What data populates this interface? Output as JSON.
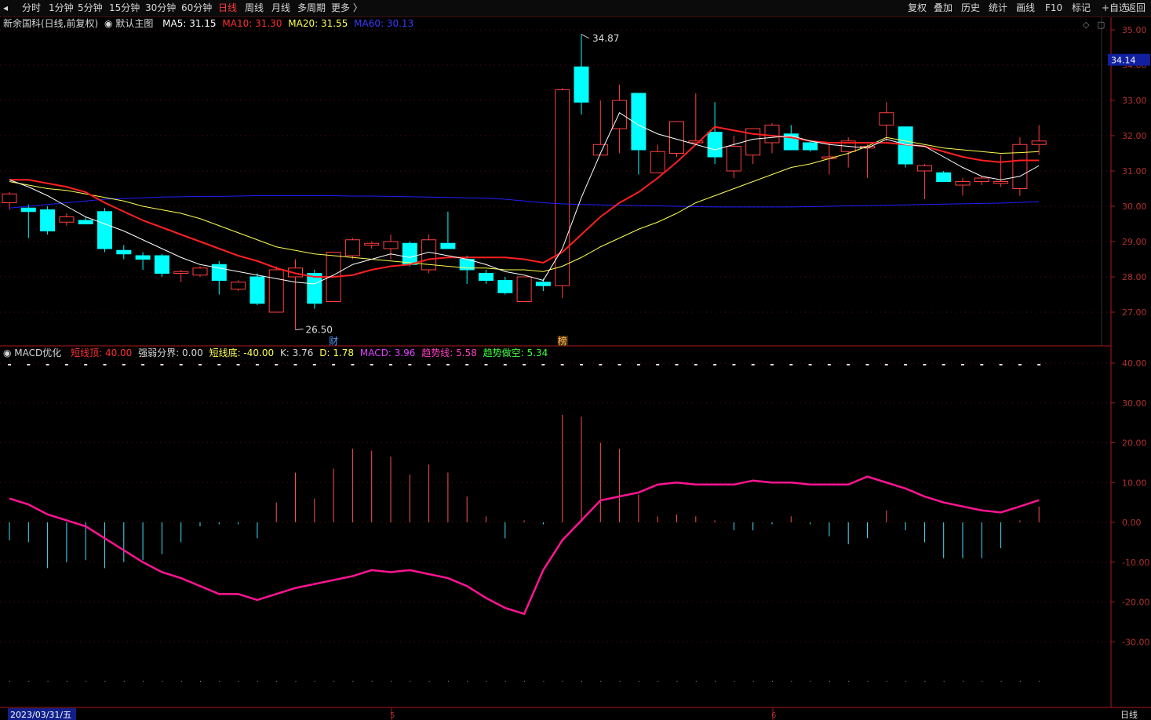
{
  "toolbar": {
    "periods": [
      "分时",
      "1分钟",
      "5分钟",
      "15分钟",
      "30分钟",
      "60分钟",
      "日线",
      "周线",
      "月线",
      "多周期",
      "更多 〉"
    ],
    "active_period": "日线",
    "right_buttons": [
      "复权",
      "叠加",
      "历史",
      "统计",
      "画线",
      "F10",
      "标记",
      "+自选",
      "返回"
    ]
  },
  "info": {
    "stock": "新余国科(日线,前复权)",
    "template": "默认主图",
    "ma5": "MA5: 31.15",
    "ma10": "MA10: 31.30",
    "ma20": "MA20: 31.55",
    "ma60": "MA60: 30.13"
  },
  "macd_info": {
    "name": "MACD优化",
    "short_top": "短线顶: 40.00",
    "strong_weak": "强弱分界: 0.00",
    "short_bottom": "短线底: -40.00",
    "k": "K: 3.76",
    "d": "D: 1.78",
    "macd": "MACD: 3.96",
    "trend": "趋势线: 5.58",
    "trend_short": "趋势做空: 5.34"
  },
  "colors": {
    "up": "#ff4040",
    "down": "#00ffff",
    "ma5": "#ffffff",
    "ma10": "#ff2020",
    "ma20": "#ffff50",
    "ma60": "#2020ff",
    "trend": "#ff1493",
    "grid": "#5a1010",
    "axis": "#b01818"
  },
  "annotations": {
    "high": "34.87",
    "low": "26.50",
    "marker_cai": "财",
    "marker_bang": "榜",
    "current_price": "34.14",
    "date": "2023/03/31/五",
    "month5": "5",
    "month6": "6",
    "period_label": "日线"
  },
  "chart_data": [
    {
      "type": "candlestick",
      "series": [
        {
          "name": "新余国科"
        }
      ],
      "ylim": [
        26.3,
        35.2
      ],
      "y_ticks": [
        "27.00",
        "28.00",
        "29.00",
        "30.00",
        "31.00",
        "32.00",
        "33.00",
        "34.00",
        "35.00"
      ],
      "candles": [
        {
          "o": 30.1,
          "h": 30.4,
          "l": 29.9,
          "c": 30.35
        },
        {
          "o": 29.95,
          "h": 30.05,
          "l": 29.1,
          "c": 29.85
        },
        {
          "o": 29.9,
          "h": 30.0,
          "l": 29.2,
          "c": 29.3
        },
        {
          "o": 29.55,
          "h": 29.8,
          "l": 29.45,
          "c": 29.7
        },
        {
          "o": 29.6,
          "h": 29.7,
          "l": 29.5,
          "c": 29.5
        },
        {
          "o": 29.85,
          "h": 29.95,
          "l": 28.7,
          "c": 28.8
        },
        {
          "o": 28.75,
          "h": 28.9,
          "l": 28.5,
          "c": 28.65
        },
        {
          "o": 28.6,
          "h": 28.7,
          "l": 28.2,
          "c": 28.5
        },
        {
          "o": 28.6,
          "h": 28.65,
          "l": 28.0,
          "c": 28.1
        },
        {
          "o": 28.1,
          "h": 28.2,
          "l": 27.85,
          "c": 28.15
        },
        {
          "o": 28.05,
          "h": 28.3,
          "l": 28.0,
          "c": 28.25
        },
        {
          "o": 28.35,
          "h": 28.45,
          "l": 27.5,
          "c": 27.9
        },
        {
          "o": 27.65,
          "h": 27.9,
          "l": 27.6,
          "c": 27.85
        },
        {
          "o": 28.0,
          "h": 28.1,
          "l": 27.2,
          "c": 27.25
        },
        {
          "o": 27.0,
          "h": 28.3,
          "l": 27.0,
          "c": 28.2
        },
        {
          "o": 28.0,
          "h": 28.5,
          "l": 26.5,
          "c": 28.25
        },
        {
          "o": 28.1,
          "h": 28.2,
          "l": 27.1,
          "c": 27.25
        },
        {
          "o": 27.3,
          "h": 28.7,
          "l": 27.3,
          "c": 28.7
        },
        {
          "o": 28.6,
          "h": 29.1,
          "l": 28.5,
          "c": 29.05
        },
        {
          "o": 28.9,
          "h": 29.0,
          "l": 28.8,
          "c": 28.95
        },
        {
          "o": 28.8,
          "h": 29.2,
          "l": 28.5,
          "c": 29.0
        },
        {
          "o": 28.95,
          "h": 29.0,
          "l": 28.3,
          "c": 28.35
        },
        {
          "o": 28.2,
          "h": 29.2,
          "l": 28.1,
          "c": 29.05
        },
        {
          "o": 28.95,
          "h": 29.85,
          "l": 28.8,
          "c": 28.8
        },
        {
          "o": 28.5,
          "h": 28.6,
          "l": 27.8,
          "c": 28.2
        },
        {
          "o": 28.1,
          "h": 28.2,
          "l": 27.8,
          "c": 27.9
        },
        {
          "o": 27.9,
          "h": 28.0,
          "l": 27.5,
          "c": 27.55
        },
        {
          "o": 27.3,
          "h": 28.0,
          "l": 27.3,
          "c": 28.0
        },
        {
          "o": 27.85,
          "h": 27.95,
          "l": 27.6,
          "c": 27.75
        },
        {
          "o": 27.75,
          "h": 33.35,
          "l": 27.4,
          "c": 33.3
        },
        {
          "o": 33.95,
          "h": 34.87,
          "l": 32.6,
          "c": 32.95
        },
        {
          "o": 31.45,
          "h": 33.0,
          "l": 31.5,
          "c": 31.75
        },
        {
          "o": 32.2,
          "h": 33.45,
          "l": 31.5,
          "c": 33.0
        },
        {
          "o": 33.2,
          "h": 33.2,
          "l": 30.9,
          "c": 31.6
        },
        {
          "o": 30.95,
          "h": 31.75,
          "l": 30.95,
          "c": 31.55
        },
        {
          "o": 31.5,
          "h": 32.4,
          "l": 31.4,
          "c": 32.4
        },
        {
          "o": 31.8,
          "h": 33.2,
          "l": 31.8,
          "c": 31.85
        },
        {
          "o": 32.1,
          "h": 32.95,
          "l": 31.2,
          "c": 31.4
        },
        {
          "o": 31.0,
          "h": 32.0,
          "l": 30.8,
          "c": 31.7
        },
        {
          "o": 31.45,
          "h": 32.2,
          "l": 31.2,
          "c": 32.2
        },
        {
          "o": 31.8,
          "h": 32.35,
          "l": 31.5,
          "c": 32.3
        },
        {
          "o": 32.05,
          "h": 32.3,
          "l": 31.6,
          "c": 31.6
        },
        {
          "o": 31.8,
          "h": 31.85,
          "l": 31.55,
          "c": 31.6
        },
        {
          "o": 31.35,
          "h": 31.8,
          "l": 30.9,
          "c": 31.4
        },
        {
          "o": 31.55,
          "h": 31.95,
          "l": 31.1,
          "c": 31.85
        },
        {
          "o": 31.65,
          "h": 31.75,
          "l": 30.8,
          "c": 31.7
        },
        {
          "o": 32.3,
          "h": 32.95,
          "l": 31.85,
          "c": 32.65
        },
        {
          "o": 32.25,
          "h": 32.25,
          "l": 31.1,
          "c": 31.2
        },
        {
          "o": 31.0,
          "h": 31.2,
          "l": 30.2,
          "c": 31.15
        },
        {
          "o": 30.95,
          "h": 31.0,
          "l": 30.7,
          "c": 30.7
        },
        {
          "o": 30.6,
          "h": 30.8,
          "l": 30.3,
          "c": 30.7
        },
        {
          "o": 30.7,
          "h": 30.85,
          "l": 30.6,
          "c": 30.8
        },
        {
          "o": 30.65,
          "h": 31.45,
          "l": 30.55,
          "c": 30.7
        },
        {
          "o": 30.5,
          "h": 31.95,
          "l": 30.3,
          "c": 31.75
        },
        {
          "o": 31.75,
          "h": 32.3,
          "l": 31.45,
          "c": 31.85
        }
      ],
      "ma5": [
        30.75,
        30.55,
        30.3,
        30.0,
        29.7,
        29.5,
        29.3,
        29.05,
        28.8,
        28.55,
        28.35,
        28.25,
        28.15,
        28.05,
        27.95,
        27.85,
        27.8,
        28.05,
        28.35,
        28.5,
        28.65,
        28.55,
        28.7,
        28.6,
        28.5,
        28.35,
        28.15,
        28.05,
        27.9,
        28.8,
        30.25,
        31.5,
        32.65,
        32.3,
        32.05,
        31.9,
        31.75,
        31.6,
        31.75,
        31.9,
        31.95,
        32.0,
        31.85,
        31.75,
        31.7,
        31.65,
        31.9,
        31.75,
        31.7,
        31.4,
        31.1,
        30.85,
        30.75,
        30.85,
        31.15
      ],
      "ma10": [
        30.75,
        30.75,
        30.65,
        30.55,
        30.4,
        30.1,
        29.85,
        29.6,
        29.4,
        29.2,
        29.0,
        28.8,
        28.6,
        28.45,
        28.25,
        28.1,
        28.0,
        28.0,
        28.05,
        28.2,
        28.3,
        28.35,
        28.5,
        28.55,
        28.55,
        28.55,
        28.55,
        28.5,
        28.4,
        28.7,
        29.2,
        29.7,
        30.1,
        30.4,
        30.8,
        31.25,
        31.75,
        32.25,
        32.15,
        32.05,
        32.0,
        31.95,
        31.85,
        31.8,
        31.8,
        31.8,
        31.8,
        31.75,
        31.7,
        31.55,
        31.4,
        31.3,
        31.25,
        31.3,
        31.3
      ],
      "ma20": [
        30.7,
        30.6,
        30.5,
        30.45,
        30.35,
        30.25,
        30.15,
        30.0,
        29.9,
        29.8,
        29.65,
        29.45,
        29.25,
        29.05,
        28.85,
        28.75,
        28.65,
        28.6,
        28.55,
        28.5,
        28.45,
        28.4,
        28.35,
        28.3,
        28.25,
        28.25,
        28.2,
        28.2,
        28.15,
        28.3,
        28.55,
        28.85,
        29.1,
        29.35,
        29.55,
        29.8,
        30.1,
        30.3,
        30.5,
        30.7,
        30.9,
        31.1,
        31.2,
        31.35,
        31.5,
        31.7,
        31.95,
        31.85,
        31.75,
        31.65,
        31.6,
        31.55,
        31.5,
        31.52,
        31.55
      ],
      "ma60": [
        29.95,
        30.0,
        30.05,
        30.1,
        30.15,
        30.2,
        30.22,
        30.24,
        30.26,
        30.27,
        30.28,
        30.28,
        30.29,
        30.3,
        30.3,
        30.3,
        30.3,
        30.3,
        30.29,
        30.29,
        30.28,
        30.27,
        30.26,
        30.25,
        30.24,
        30.23,
        30.2,
        30.15,
        30.1,
        30.07,
        30.05,
        30.04,
        30.03,
        30.02,
        30.01,
        30.0,
        29.99,
        29.98,
        29.98,
        29.98,
        29.98,
        29.98,
        29.99,
        30.0,
        30.01,
        30.02,
        30.03,
        30.04,
        30.05,
        30.06,
        30.07,
        30.08,
        30.09,
        30.11,
        30.13
      ]
    },
    {
      "type": "bar",
      "series": [
        {
          "name": "MACD"
        },
        {
          "name": "趋势线"
        }
      ],
      "ylim": [
        -40,
        40
      ],
      "y_ticks": [
        "40.00",
        "30.00",
        "20.00",
        "10.00",
        "0.00",
        "-10.00",
        "-20.00",
        "-30.00"
      ],
      "macd": [
        -4.5,
        -5,
        -11.5,
        -10,
        -9.5,
        -11.5,
        -10,
        -9.5,
        -8,
        -5,
        -1,
        -0.5,
        -0.5,
        -4,
        5,
        12.5,
        6,
        13.5,
        18.5,
        18,
        16.5,
        12,
        14.5,
        12.5,
        6.5,
        1.5,
        -4,
        0.5,
        -0.5,
        27,
        26.5,
        20,
        18.5,
        7,
        1.5,
        2,
        1.5,
        0.5,
        -2,
        -2,
        -0.5,
        1.5,
        -0.5,
        -3.5,
        -5.5,
        -4,
        3,
        -2,
        -5,
        -9,
        -9,
        -9,
        -6.5,
        0.5,
        3.96
      ],
      "trend": [
        6,
        4.5,
        2,
        0.5,
        -1,
        -4,
        -7,
        -10,
        -12.5,
        -14,
        -16,
        -18,
        -18,
        -19.5,
        -18,
        -16.5,
        -15.5,
        -14.5,
        -13.5,
        -12,
        -12.5,
        -12,
        -13,
        -14,
        -16,
        -19,
        -21.5,
        -23,
        -12,
        -4.5,
        0.5,
        5.5,
        6.5,
        7.5,
        9.5,
        10,
        9.5,
        9.5,
        9.5,
        10.5,
        10,
        10,
        9.5,
        9.5,
        9.5,
        11.5,
        10,
        8.5,
        6.5,
        5,
        4,
        3,
        2.5,
        4,
        5.58
      ]
    }
  ]
}
